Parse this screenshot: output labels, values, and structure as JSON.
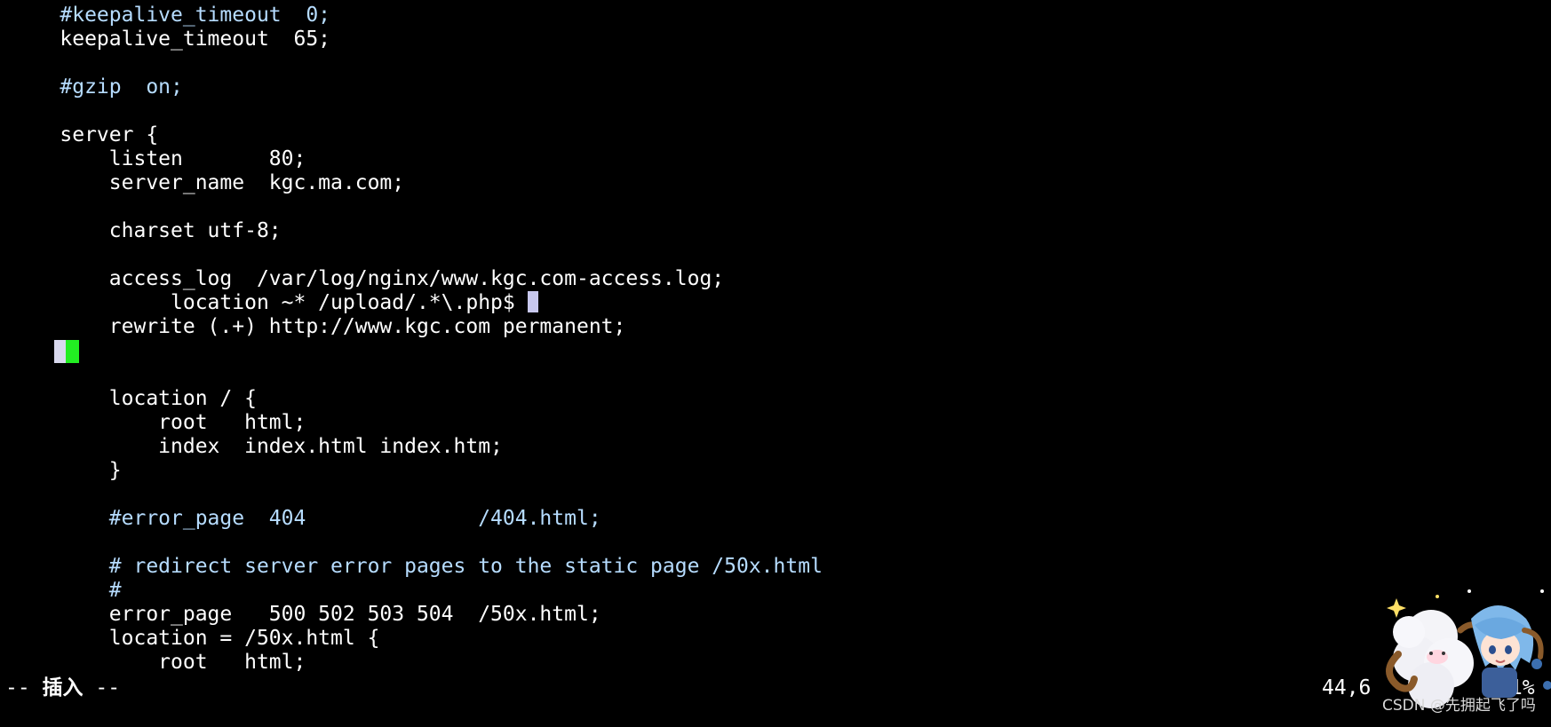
{
  "editor": {
    "lines": [
      {
        "indent": "    ",
        "text": "#keepalive_timeout  0;",
        "kind": "comment"
      },
      {
        "indent": "    ",
        "text": "keepalive_timeout  65;",
        "kind": "normal"
      },
      {
        "indent": "",
        "text": "",
        "kind": "normal"
      },
      {
        "indent": "    ",
        "text": "#gzip  on;",
        "kind": "comment"
      },
      {
        "indent": "",
        "text": "",
        "kind": "normal"
      },
      {
        "indent": "    ",
        "text": "server {",
        "kind": "normal"
      },
      {
        "indent": "        ",
        "text": "listen       80;",
        "kind": "normal"
      },
      {
        "indent": "        ",
        "text": "server_name  kgc.ma.com;",
        "kind": "normal"
      },
      {
        "indent": "",
        "text": "",
        "kind": "normal"
      },
      {
        "indent": "        ",
        "text": "charset utf-8;",
        "kind": "normal"
      },
      {
        "indent": "",
        "text": "",
        "kind": "normal"
      },
      {
        "indent": "        ",
        "text": "access_log  /var/log/nginx/www.kgc.com-access.log;",
        "kind": "normal"
      },
      {
        "indent": "             ",
        "text": "location ~* /upload/.*\\.php$ ",
        "kind": "normal",
        "cursor": true
      },
      {
        "indent": "        ",
        "text": "rewrite (.+) http://www.kgc.com permanent;",
        "kind": "normal"
      },
      {
        "indent": "",
        "text": "",
        "kind": "normal"
      },
      {
        "indent": "",
        "text": "",
        "kind": "normal"
      },
      {
        "indent": "        ",
        "text": "location / {",
        "kind": "normal"
      },
      {
        "indent": "            ",
        "text": "root   html;",
        "kind": "normal"
      },
      {
        "indent": "            ",
        "text": "index  index.html index.htm;",
        "kind": "normal"
      },
      {
        "indent": "        ",
        "text": "}",
        "kind": "normal"
      },
      {
        "indent": "",
        "text": "",
        "kind": "normal"
      },
      {
        "indent": "        ",
        "text": "#error_page  404              /404.html;",
        "kind": "comment"
      },
      {
        "indent": "",
        "text": "",
        "kind": "normal"
      },
      {
        "indent": "        ",
        "text": "# redirect server error pages to the static page /50x.html",
        "kind": "comment"
      },
      {
        "indent": "        ",
        "text": "#",
        "kind": "comment"
      },
      {
        "indent": "        ",
        "text": "error_page   500 502 503 504  /50x.html;",
        "kind": "normal"
      },
      {
        "indent": "        ",
        "text": "location = /50x.html {",
        "kind": "normal"
      },
      {
        "indent": "            ",
        "text": "root   html;",
        "kind": "normal"
      }
    ]
  },
  "status": {
    "mode_prefix": "-- ",
    "mode_label": "插入",
    "mode_suffix": " --",
    "position": "44,6",
    "percent": "31%"
  },
  "watermark": {
    "text": "CSDN @先拥起飞了吗"
  },
  "colors": {
    "background": "#000000",
    "text": "#ffffff",
    "comment": "#b6dcff",
    "cursor": "#c8c8ee",
    "cursor_green": "#22ee22"
  },
  "icons": {
    "mascot": "sheep-mascot-icon"
  }
}
